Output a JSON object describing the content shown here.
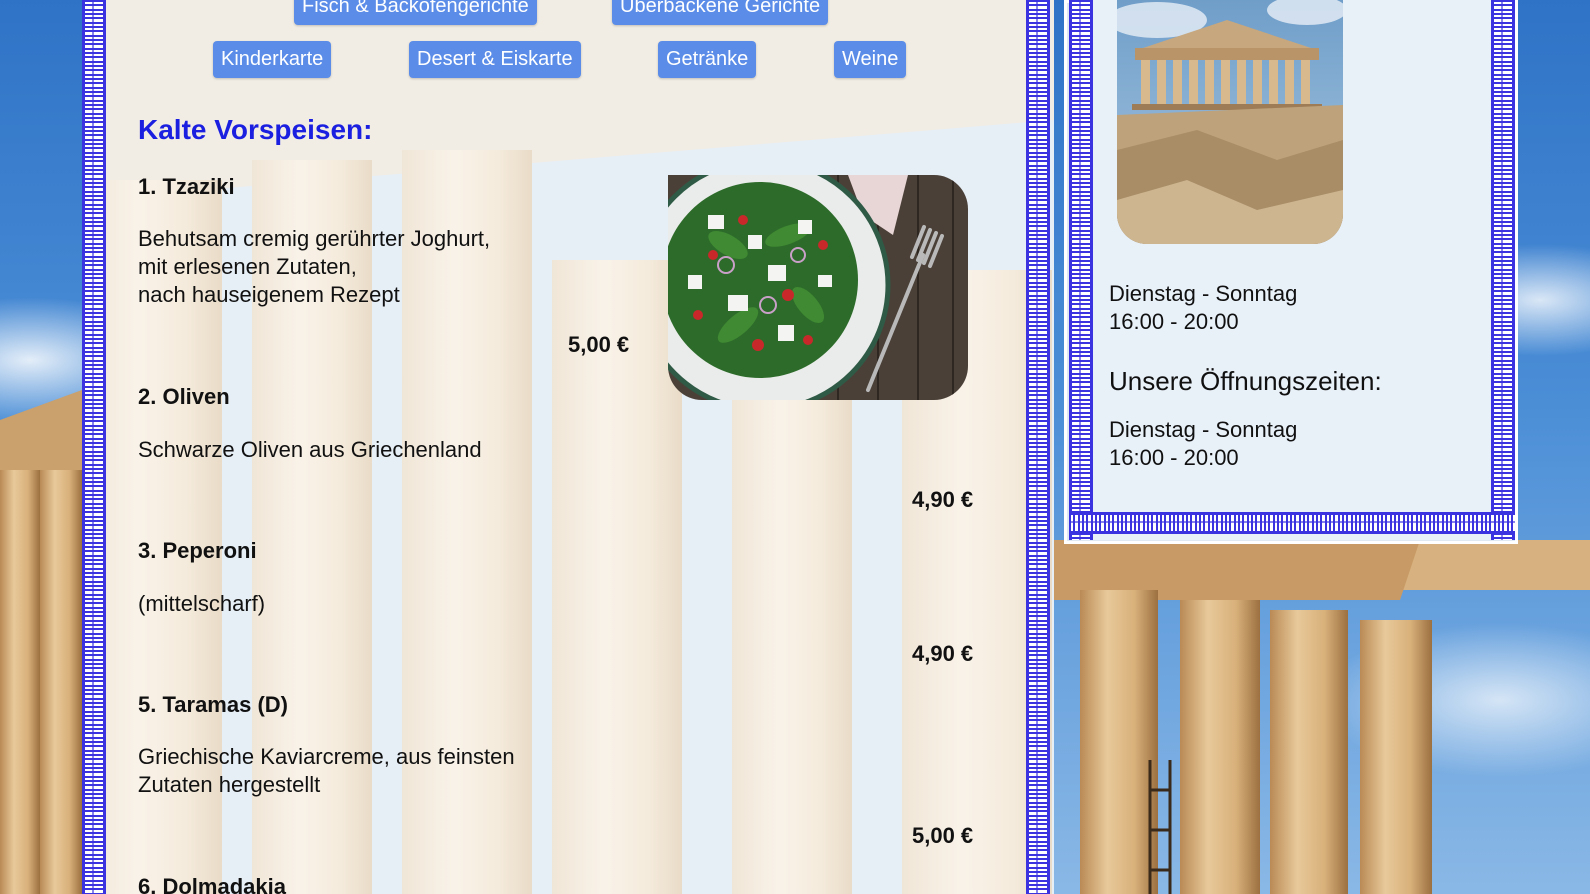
{
  "nav": {
    "top_row": [
      "Fisch & Backofengerichte",
      "Überbackene Gerichte"
    ],
    "second_row": [
      "Kinderkarte",
      "Desert & Eiskarte",
      "Getränke",
      "Weine"
    ]
  },
  "menu": {
    "section_title": "Kalte Vorspeisen:",
    "items": [
      {
        "name": "1. Tzaziki",
        "desc": "Behutsam cremig gerührter Joghurt,\nmit erlesenen Zutaten,\nnach hauseigenem Rezept",
        "price": "5,00 €"
      },
      {
        "name": "2. Oliven",
        "desc": "Schwarze Oliven aus Griechenland",
        "price": "4,90 €"
      },
      {
        "name": "3. Peperoni",
        "desc": "(mittelscharf)",
        "price": "4,90 €"
      },
      {
        "name": "5. Taramas (D)",
        "desc": "Griechische Kaviarcreme, aus feinsten\nZutaten hergestellt",
        "price": "5,00 €"
      },
      {
        "name": "6. Dolmadakia",
        "desc": "",
        "price": ""
      }
    ]
  },
  "sidebar": {
    "hours_1": "Dienstag - Sonntag\n16:00 - 20:00",
    "heading": "Unsere Öffnungszeiten:",
    "hours_2": "Dienstag - Sonntag\n16:00 - 20:00"
  },
  "colors": {
    "accent_button": "#5b8de8",
    "section_title": "#1a1fe0",
    "meander_border": "#3b33e0"
  },
  "icons": {
    "salad_photo": "salad-photo",
    "temple_photo": "parthenon-photo"
  }
}
